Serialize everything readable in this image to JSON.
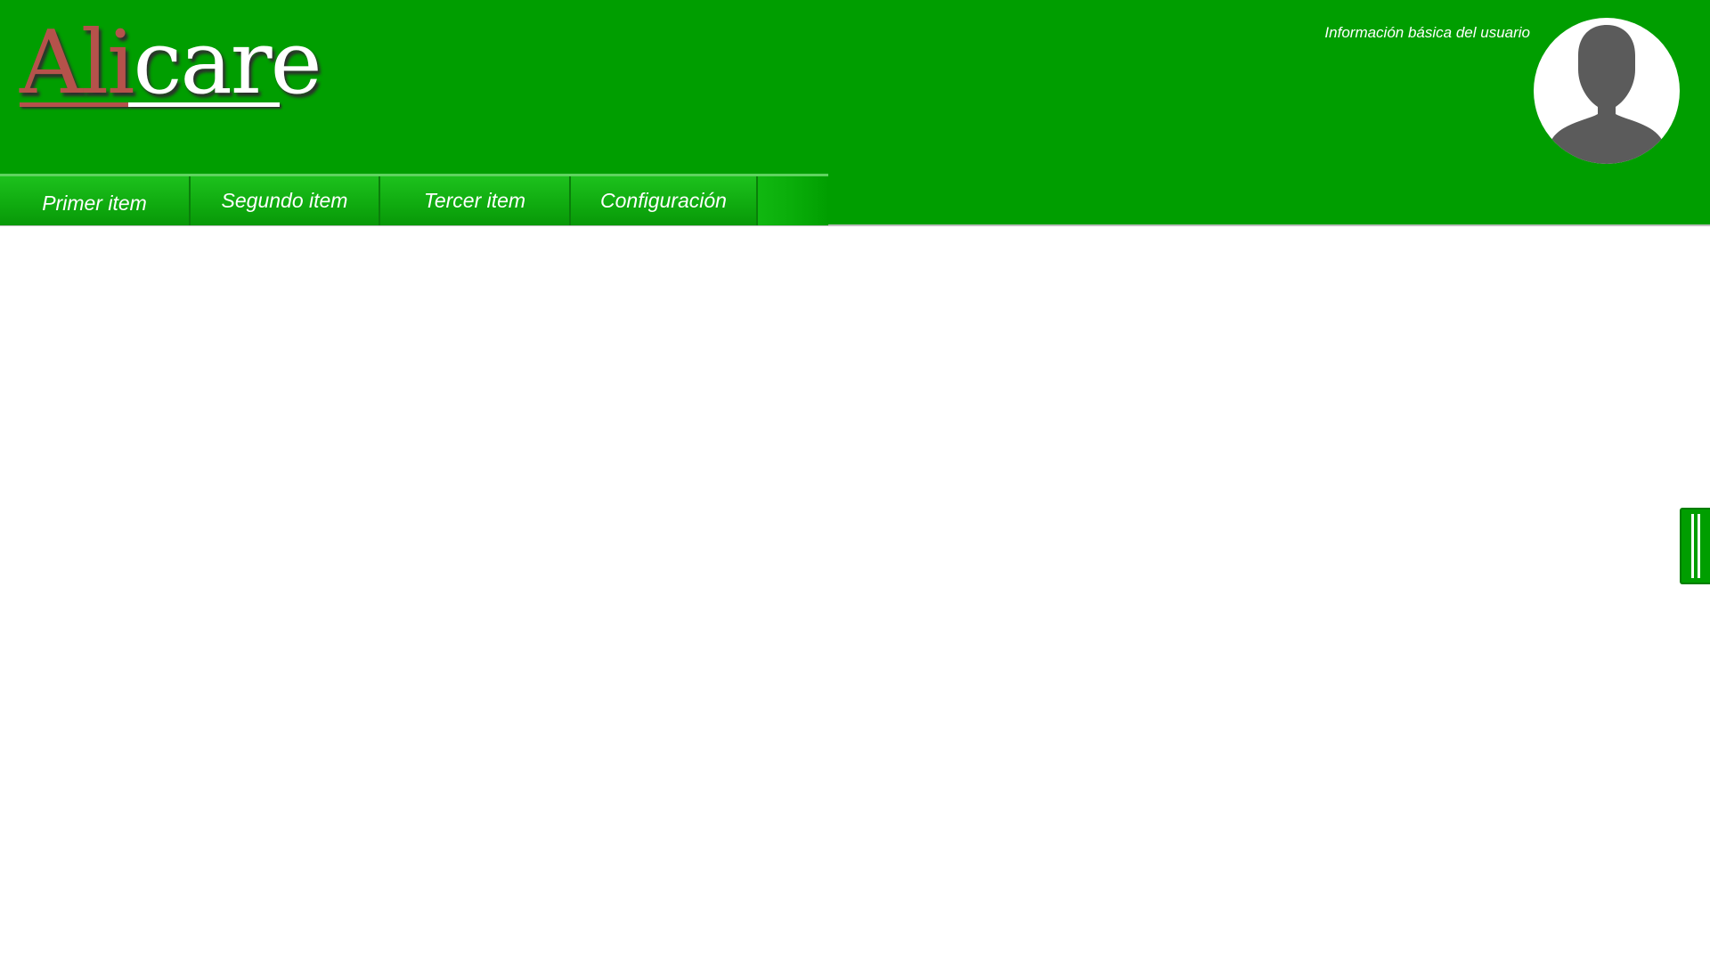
{
  "app": {
    "logo": {
      "part1": "Ali",
      "part2": "care"
    }
  },
  "header": {
    "user_info_label": "Información básica del usuario",
    "avatar_icon": "user-silhouette-icon"
  },
  "nav": {
    "items": [
      {
        "label": "Primer item"
      },
      {
        "label": "Segundo item"
      },
      {
        "label": "Tercer item"
      },
      {
        "label": "Configuración"
      }
    ]
  },
  "side_handle": {
    "icon": "drag-handle-icon"
  },
  "colors": {
    "header_green": "#009e00",
    "nav_green": "#10b710",
    "logo_red": "#b5524b",
    "avatar_gray": "#5b5b5b"
  }
}
